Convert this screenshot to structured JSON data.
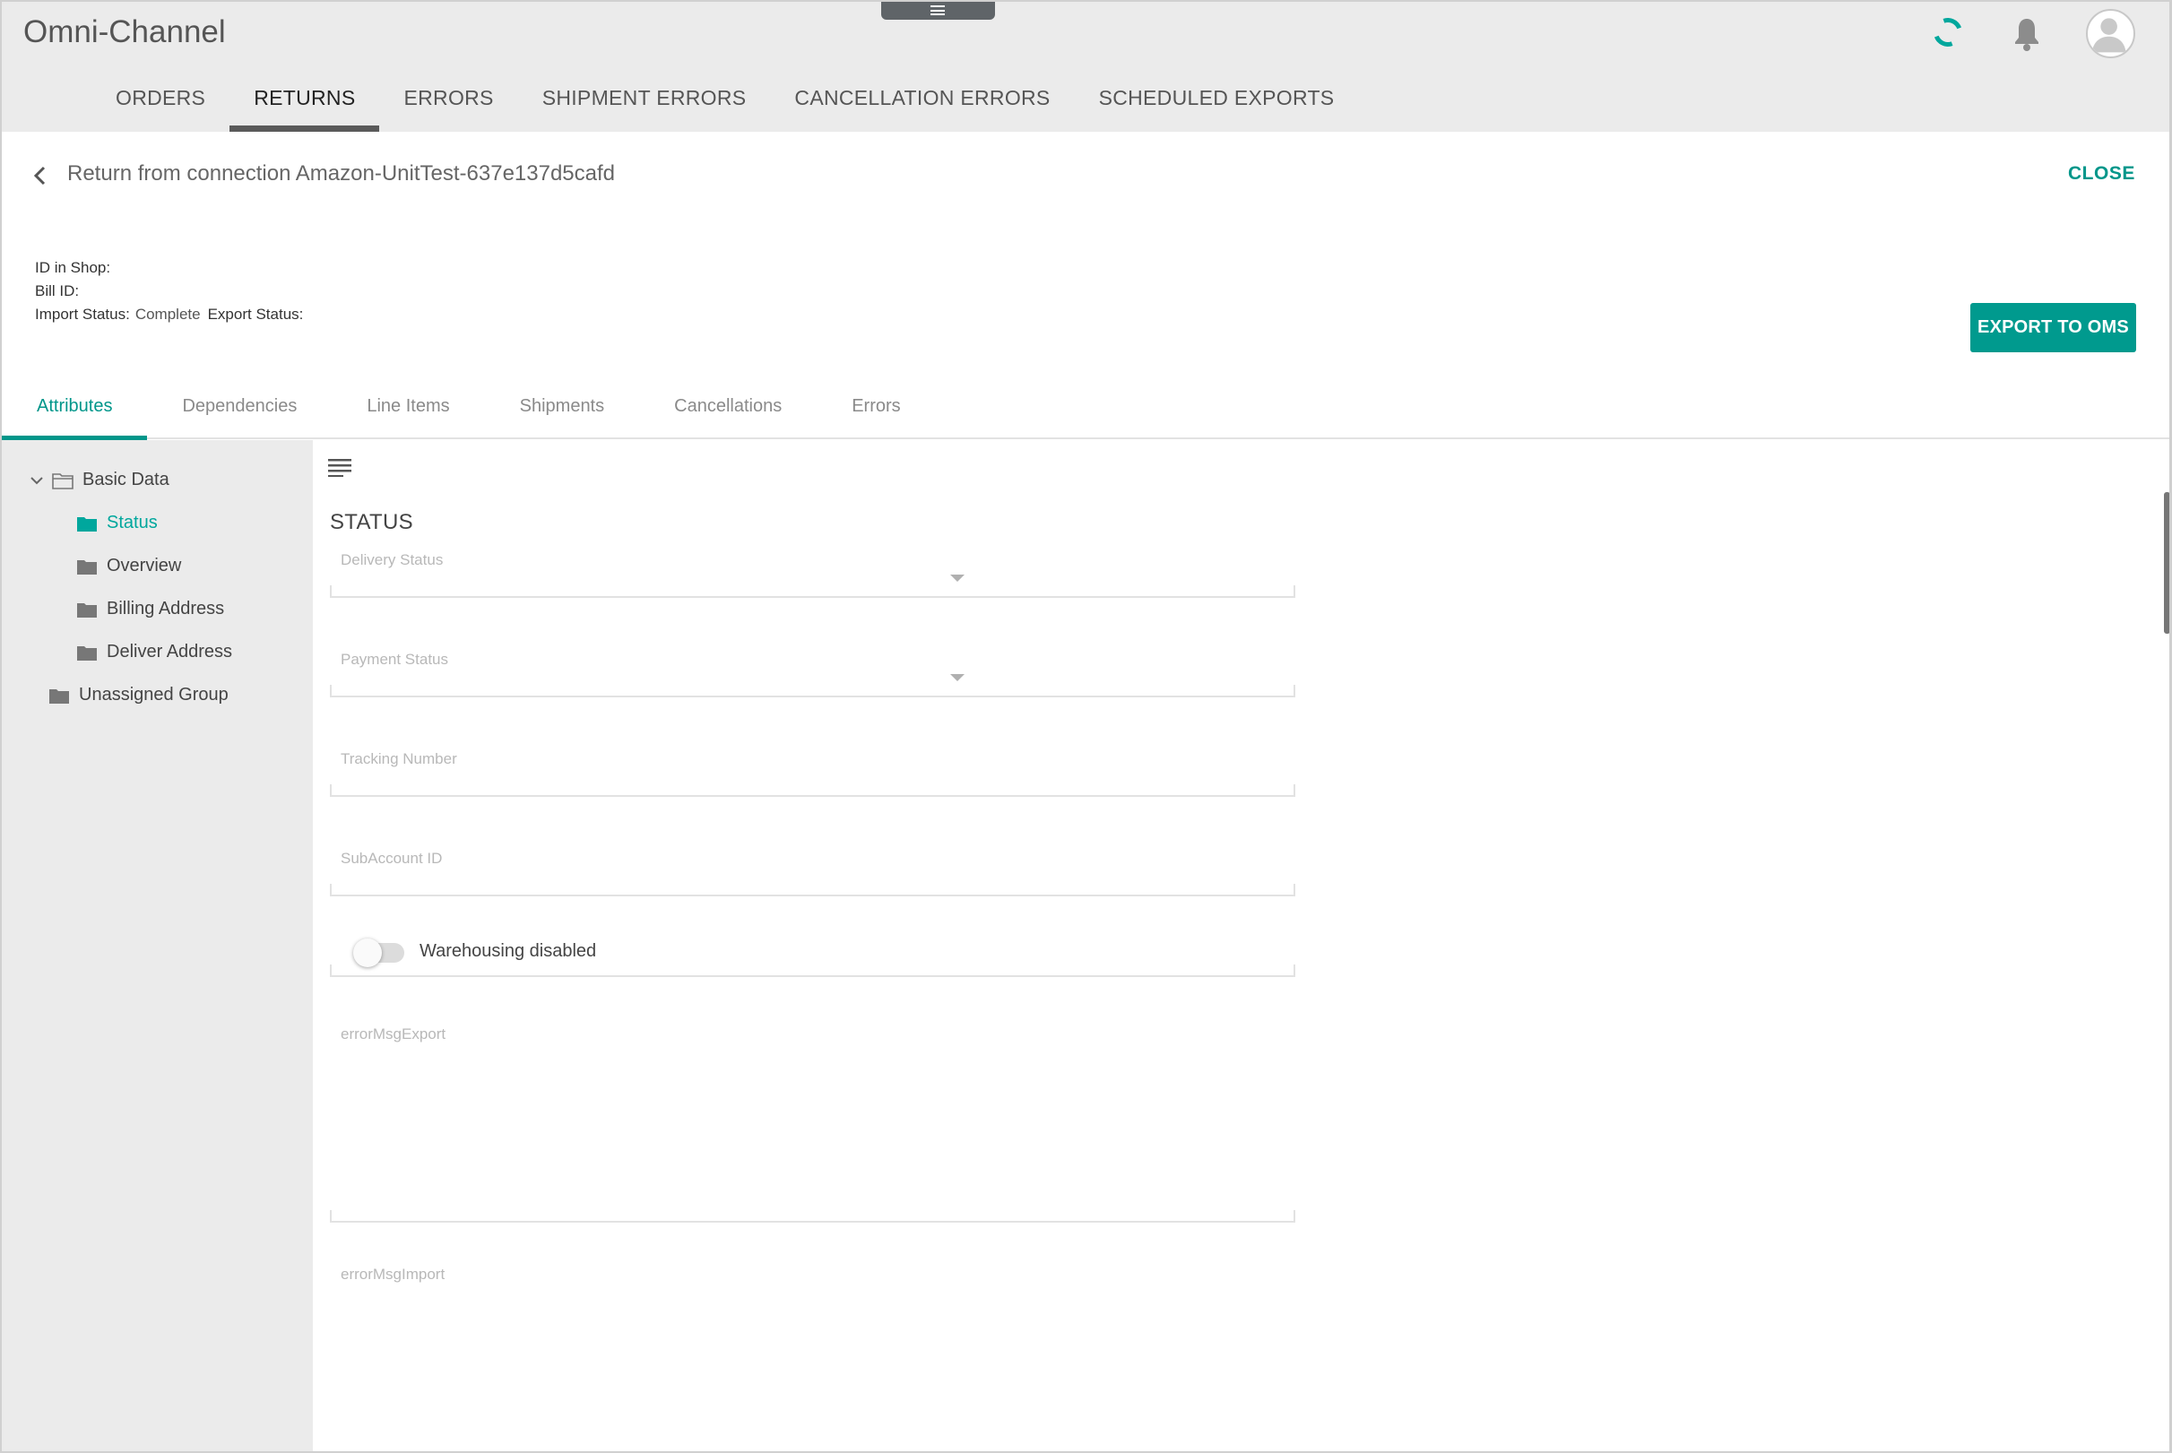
{
  "header": {
    "app_title": "Omni-Channel",
    "icons": [
      "hamburger-handle-icon",
      "sync-spinner-icon",
      "bell-icon",
      "user-avatar-icon"
    ],
    "nav_tabs": [
      {
        "label": "ORDERS",
        "active": false
      },
      {
        "label": "RETURNS",
        "active": true
      },
      {
        "label": "ERRORS",
        "active": false
      },
      {
        "label": "SHIPMENT ERRORS",
        "active": false
      },
      {
        "label": "CANCELLATION ERRORS",
        "active": false
      },
      {
        "label": "SCHEDULED EXPORTS",
        "active": false
      }
    ]
  },
  "detail": {
    "title": "Return from connection Amazon-UnitTest-637e137d5cafd",
    "close_label": "CLOSE",
    "id_in_shop_label": "ID in Shop:",
    "id_in_shop_value": "",
    "bill_id_label": "Bill ID:",
    "bill_id_value": "",
    "import_status_label": "Import Status:",
    "import_status_value": "Complete",
    "export_status_label": "Export Status:",
    "export_status_value": "",
    "export_button_label": "EXPORT TO OMS",
    "accent_color": "#009a8e"
  },
  "detail_tabs": [
    {
      "label": "Attributes",
      "active": true
    },
    {
      "label": "Dependencies",
      "active": false
    },
    {
      "label": "Line Items",
      "active": false
    },
    {
      "label": "Shipments",
      "active": false
    },
    {
      "label": "Cancellations",
      "active": false
    },
    {
      "label": "Errors",
      "active": false
    }
  ],
  "tree": {
    "root": {
      "label": "Basic Data",
      "expanded": true
    },
    "children": [
      {
        "label": "Status",
        "active": true
      },
      {
        "label": "Overview",
        "active": false
      },
      {
        "label": "Billing Address",
        "active": false
      },
      {
        "label": "Deliver Address",
        "active": false
      }
    ],
    "other": {
      "label": "Unassigned Group"
    }
  },
  "form": {
    "section_title": "STATUS",
    "delivery_status_label": "Delivery Status",
    "delivery_status_value": "",
    "payment_status_label": "Payment Status",
    "payment_status_value": "",
    "tracking_number_label": "Tracking Number",
    "tracking_number_value": "",
    "subaccount_id_label": "SubAccount ID",
    "subaccount_id_value": "",
    "warehousing_label": "Warehousing disabled",
    "warehousing_on": false,
    "error_msg_export_label": "errorMsgExport",
    "error_msg_export_value": "",
    "error_msg_import_label": "errorMsgImport",
    "error_msg_import_value": ""
  }
}
